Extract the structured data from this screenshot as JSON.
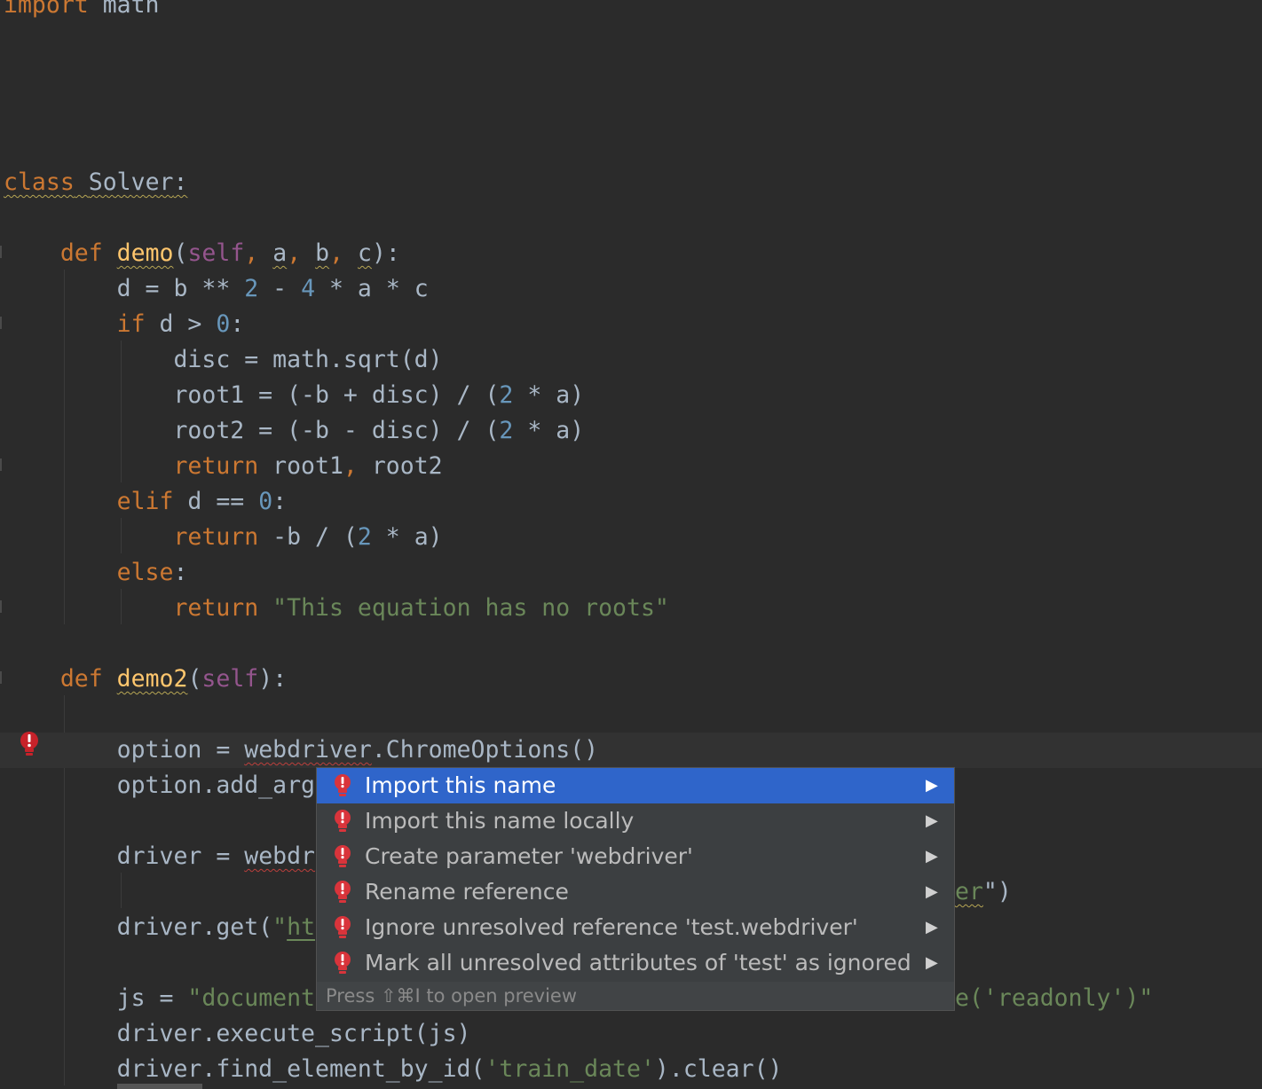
{
  "editor": {
    "lines": {
      "l1": {
        "t1": "import",
        "t2": " math"
      },
      "l6": {
        "t1": "class",
        "t2": " ",
        "t3": "Solver",
        "t4": ":"
      },
      "l8": {
        "t1": "    ",
        "t2": "def",
        "t3": " ",
        "t4": "demo",
        "t5": "(",
        "t6": "self",
        "t7": ", ",
        "t8": "a",
        "t9": ", ",
        "t10": "b",
        "t11": ", ",
        "t12": "c",
        "t13": "):"
      },
      "l9": {
        "t1": "        d = b ** ",
        "t2": "2",
        "t3": " - ",
        "t4": "4",
        "t5": " * a * c"
      },
      "l10": {
        "t1": "        ",
        "t2": "if",
        "t3": " d > ",
        "t4": "0",
        "t5": ":"
      },
      "l11": {
        "t1": "            disc = math.sqrt(d)"
      },
      "l12": {
        "t1": "            root1 = (-b + disc) / (",
        "t2": "2",
        "t3": " * a)"
      },
      "l13": {
        "t1": "            root2 = (-b - disc) / (",
        "t2": "2",
        "t3": " * a)"
      },
      "l14": {
        "t1": "            ",
        "t2": "return",
        "t3": " root1",
        "t4": ",",
        "t5": " root2"
      },
      "l15": {
        "t1": "        ",
        "t2": "elif",
        "t3": " d == ",
        "t4": "0",
        "t5": ":"
      },
      "l16": {
        "t1": "            ",
        "t2": "return",
        "t3": " -b / (",
        "t4": "2",
        "t5": " * a)"
      },
      "l17": {
        "t1": "        ",
        "t2": "else",
        "t3": ":"
      },
      "l18": {
        "t1": "            ",
        "t2": "return",
        "t3": " ",
        "t4": "\"This equation has no roots\""
      },
      "l20": {
        "t1": "    ",
        "t2": "def",
        "t3": " ",
        "t4": "demo2",
        "t5": "(",
        "t6": "self",
        "t7": "):"
      },
      "l22": {
        "t1": "        option = ",
        "t2": "webdriver",
        "t3": ".ChromeOptions()"
      },
      "l23": {
        "t1": "        option.add_arg"
      },
      "l25": {
        "t1": "        driver = ",
        "t2": "webdr"
      },
      "l26": {
        "t1": "er",
        "t2": "\")"
      },
      "l27": {
        "t1": "        driver.get(",
        "t2": "\"",
        "t3": "ht"
      },
      "l29": {
        "t1": "        js = ",
        "t2": "\"document",
        "t3": "e('readonly')\""
      },
      "l30": {
        "t1": "        driver.execute_script(js)"
      },
      "l31": {
        "t1": "        driver.find_element_by_id(",
        "t2": "'train_date'",
        "t3": ").clear()"
      }
    }
  },
  "popup": {
    "items": [
      {
        "label": "Import this name"
      },
      {
        "label": "Import this name locally"
      },
      {
        "label": "Create parameter 'webdriver'"
      },
      {
        "label": "Rename reference"
      },
      {
        "label": "Ignore unresolved reference 'test.webdriver'"
      },
      {
        "label": "Mark all unresolved attributes of 'test' as ignored"
      }
    ],
    "arrow_glyph": "▶",
    "footer": "Press ⇧⌘I to open preview"
  },
  "colors": {
    "background": "#2b2b2b",
    "keyword": "#cc7832",
    "number": "#6897bb",
    "string": "#6a8759",
    "function": "#ffc66d",
    "selection": "#2f65ca",
    "error": "#bc3f3c"
  },
  "icons": {
    "gutter": "error-bulb-icon",
    "popup_item": "red-bulb-icon",
    "submenu": "arrow-right-icon"
  }
}
